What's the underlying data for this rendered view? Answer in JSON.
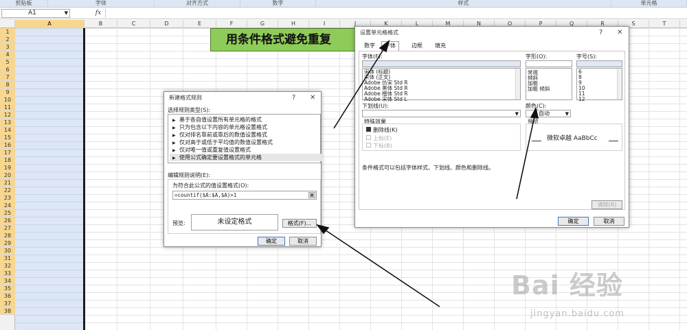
{
  "ribbon": {
    "groups": [
      "剪贴板",
      "字体",
      "对齐方式",
      "数字",
      "样式",
      "单元格"
    ]
  },
  "formula_bar": {
    "name_box": "A1",
    "fx": "fx"
  },
  "grid": {
    "columns": [
      "A",
      "B",
      "C",
      "D",
      "E",
      "F",
      "G",
      "H",
      "I",
      "J",
      "K",
      "L",
      "M",
      "N",
      "O",
      "P",
      "Q",
      "R",
      "S",
      "T"
    ],
    "rows": [
      "1",
      "2",
      "3",
      "4",
      "5",
      "6",
      "7",
      "8",
      "9",
      "10",
      "11",
      "12",
      "13",
      "14",
      "15",
      "16",
      "17",
      "18",
      "19",
      "20",
      "21",
      "22",
      "23",
      "24",
      "25",
      "26",
      "27",
      "28",
      "29",
      "30",
      "31",
      "32",
      "33",
      "34",
      "35",
      "36",
      "37",
      "38"
    ],
    "banner_text": "用条件格式避免重复"
  },
  "rule_dialog": {
    "title": "新建格式规则",
    "help": "?",
    "close": "✕",
    "select_type_label": "选择规则类型(S):",
    "rule_types": [
      "基于各自值设置所有单元格的格式",
      "只为包含以下内容的单元格设置格式",
      "仅对排名靠前或靠后的数值设置格式",
      "仅对高于或低于平均值的数值设置格式",
      "仅对唯一值或重复值设置格式",
      "使用公式确定要设置格式的单元格"
    ],
    "edit_desc_label": "编辑规则说明(E):",
    "formula_label": "为符合此公式的值设置格式(O):",
    "formula_value": "=countif($A:$A,$A)>1",
    "preview_label": "预览:",
    "preview_text": "未设定格式",
    "format_button": "格式(F)...",
    "ok": "确定",
    "cancel": "取消"
  },
  "format_dialog": {
    "title": "设置单元格格式",
    "help": "?",
    "close": "✕",
    "tabs": [
      "数字",
      "字体",
      "边框",
      "填充"
    ],
    "font_label": "字体(F):",
    "font_items": [
      "宋体 (标题)",
      "宋体 (正文)",
      "Adobe 仿宋 Std R",
      "Adobe 黑体 Std R",
      "Adobe 楷体 Std R",
      "Adobe 宋体 Std L"
    ],
    "style_label": "字形(O):",
    "style_items": [
      "常规",
      "倾斜",
      "加粗",
      "加粗 倾斜"
    ],
    "size_label": "字号(S):",
    "size_items": [
      "6",
      "8",
      "9",
      "10",
      "11",
      "12"
    ],
    "underline_label": "下划线(U):",
    "color_label": "颜色(C):",
    "color_value": "自动",
    "effects_label": "特殊效果",
    "effects": [
      "删除线(K)",
      "上标(E)",
      "下标(B)"
    ],
    "preview_label": "预览",
    "preview_text": "微软卓越  AaBbCc",
    "note": "条件格式可以包括字体样式、下划线、颜色和删除线。",
    "clear_button": "清除(R)",
    "ok": "确定",
    "cancel": "取消"
  },
  "watermark": {
    "brand": "Bai 经验",
    "url": "jingyan.baidu.com"
  },
  "colors": {
    "banner": "#8fcb58",
    "selection_header": "#f7d68e",
    "column_a_fill": "#dce6f4",
    "arrow": "#111111"
  }
}
